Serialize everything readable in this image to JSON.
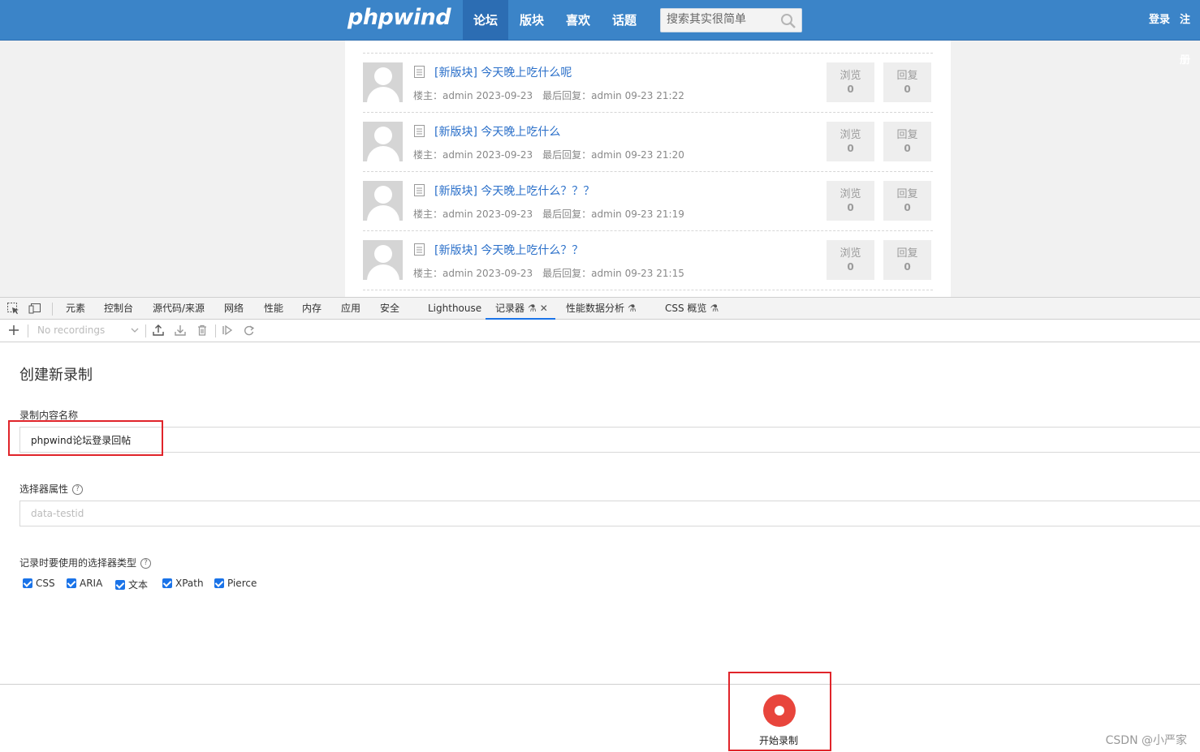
{
  "site": {
    "logo": "phpwind",
    "nav": [
      "论坛",
      "版块",
      "喜欢",
      "话题"
    ],
    "search_placeholder": "搜索其实很简单",
    "login": "登录",
    "register": "注册"
  },
  "threads": [
    {
      "title": "[新版块] 今天晚上吃什么呢",
      "owner": "楼主：admin 2023-09-23",
      "last_reply": "最后回复：admin 09-23 21:22",
      "views_label": "浏览",
      "views": "0",
      "replies_label": "回复",
      "replies": "0"
    },
    {
      "title": "[新版块] 今天晚上吃什么",
      "owner": "楼主：admin 2023-09-23",
      "last_reply": "最后回复：admin 09-23 21:20",
      "views_label": "浏览",
      "views": "0",
      "replies_label": "回复",
      "replies": "0"
    },
    {
      "title": "[新版块] 今天晚上吃什么？？？",
      "owner": "楼主：admin 2023-09-23",
      "last_reply": "最后回复：admin 09-23 21:19",
      "views_label": "浏览",
      "views": "0",
      "replies_label": "回复",
      "replies": "0"
    },
    {
      "title": "[新版块] 今天晚上吃什么？？",
      "owner": "楼主：admin 2023-09-23",
      "last_reply": "最后回复：admin 09-23 21:15",
      "views_label": "浏览",
      "views": "0",
      "replies_label": "回复",
      "replies": "0"
    }
  ],
  "devtools": {
    "tabs": [
      "元素",
      "控制台",
      "源代码/来源",
      "网络",
      "性能",
      "内存",
      "应用",
      "安全",
      "Lighthouse",
      "记录器",
      "性能数据分析",
      "CSS 概览"
    ],
    "active_tab": "记录器",
    "recordings_select": "No recordings",
    "panel_title": "创建新录制",
    "name_label": "录制内容名称",
    "name_value": "phpwind论坛登录回帖",
    "selector_attr_label": "选择器属性",
    "selector_attr_placeholder": "data-testid",
    "selector_types_label": "记录时要使用的选择器类型",
    "selector_types": [
      "CSS",
      "ARIA",
      "文本",
      "XPath",
      "Pierce"
    ],
    "start_button": "开始录制"
  },
  "watermark": "CSDN @小严家"
}
